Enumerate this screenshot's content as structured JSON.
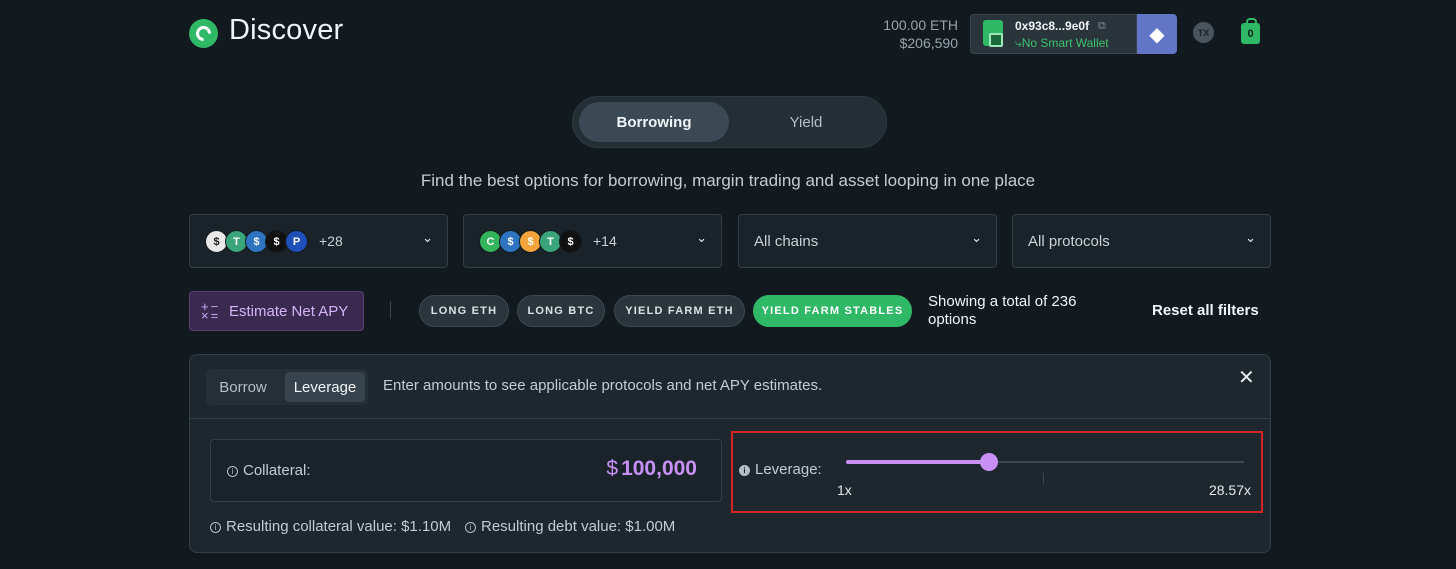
{
  "header": {
    "title": "Discover",
    "balance_eth": "100.00 ETH",
    "balance_usd": "$206,590",
    "wallet_address": "0x93c8...9e0f",
    "wallet_status": "No Smart Wallet",
    "tx_label": "TX",
    "bag_count": "0"
  },
  "mode_tabs": {
    "active": "Borrowing",
    "inactive": "Yield"
  },
  "subtitle": "Find the best options for borrowing, margin trading and asset looping in one place",
  "dropdowns": {
    "collateral_tokens": {
      "count": "+28",
      "tokens": [
        {
          "icon": "usdc-token-icon",
          "color": "#e8e8e8",
          "glyph": "$",
          "fg": "#1a1a1a"
        },
        {
          "icon": "usdt-token-icon",
          "color": "#3aa57a",
          "glyph": "T",
          "fg": "#ffffff"
        },
        {
          "icon": "usdc-blue-token-icon",
          "color": "#2f74c0",
          "glyph": "$",
          "fg": "#ffffff"
        },
        {
          "icon": "dollar-black-token-icon",
          "color": "#111111",
          "glyph": "$",
          "fg": "#ffffff"
        },
        {
          "icon": "pyusd-token-icon",
          "color": "#1f4fb8",
          "glyph": "P",
          "fg": "#ffffff"
        }
      ]
    },
    "debt_tokens": {
      "count": "+14",
      "tokens": [
        {
          "icon": "green-cycle-token-icon",
          "color": "#33b35a",
          "glyph": "C",
          "fg": "#ffffff"
        },
        {
          "icon": "usdc-blue-token-icon",
          "color": "#2f74c0",
          "glyph": "$",
          "fg": "#ffffff"
        },
        {
          "icon": "dai-orange-token-icon",
          "color": "#f2a43a",
          "glyph": "$",
          "fg": "#ffffff"
        },
        {
          "icon": "usdt-token-icon",
          "color": "#3aa57a",
          "glyph": "T",
          "fg": "#ffffff"
        },
        {
          "icon": "dollar-black-token-icon",
          "color": "#111111",
          "glyph": "$",
          "fg": "#ffffff"
        }
      ]
    },
    "chains": "All chains",
    "protocols": "All protocols"
  },
  "filters": {
    "estimate_label": "Estimate Net APY",
    "chips": [
      "LONG ETH",
      "LONG BTC",
      "YIELD FARM ETH",
      "YIELD FARM STABLES"
    ],
    "active_chip": "YIELD FARM STABLES",
    "showing": "Showing a total of 236 options",
    "reset": "Reset all filters"
  },
  "panel": {
    "tab_borrow": "Borrow",
    "tab_leverage": "Leverage",
    "hint": "Enter amounts to see applicable protocols and net APY estimates.",
    "collateral_label": "Collateral:",
    "collateral_currency": "$",
    "collateral_value": "100,000",
    "leverage_label": "Leverage:",
    "leverage_min": "1x",
    "leverage_max": "28.57x",
    "leverage_slider_fraction": 0.36,
    "resulting_collateral": "Resulting collateral value: $1.10M",
    "resulting_debt": "Resulting debt value: $1.00M"
  },
  "colors": {
    "accent_green": "#2fb866",
    "accent_purple": "#c890f5",
    "highlight_red": "#d32525",
    "background": "#121a1f"
  }
}
